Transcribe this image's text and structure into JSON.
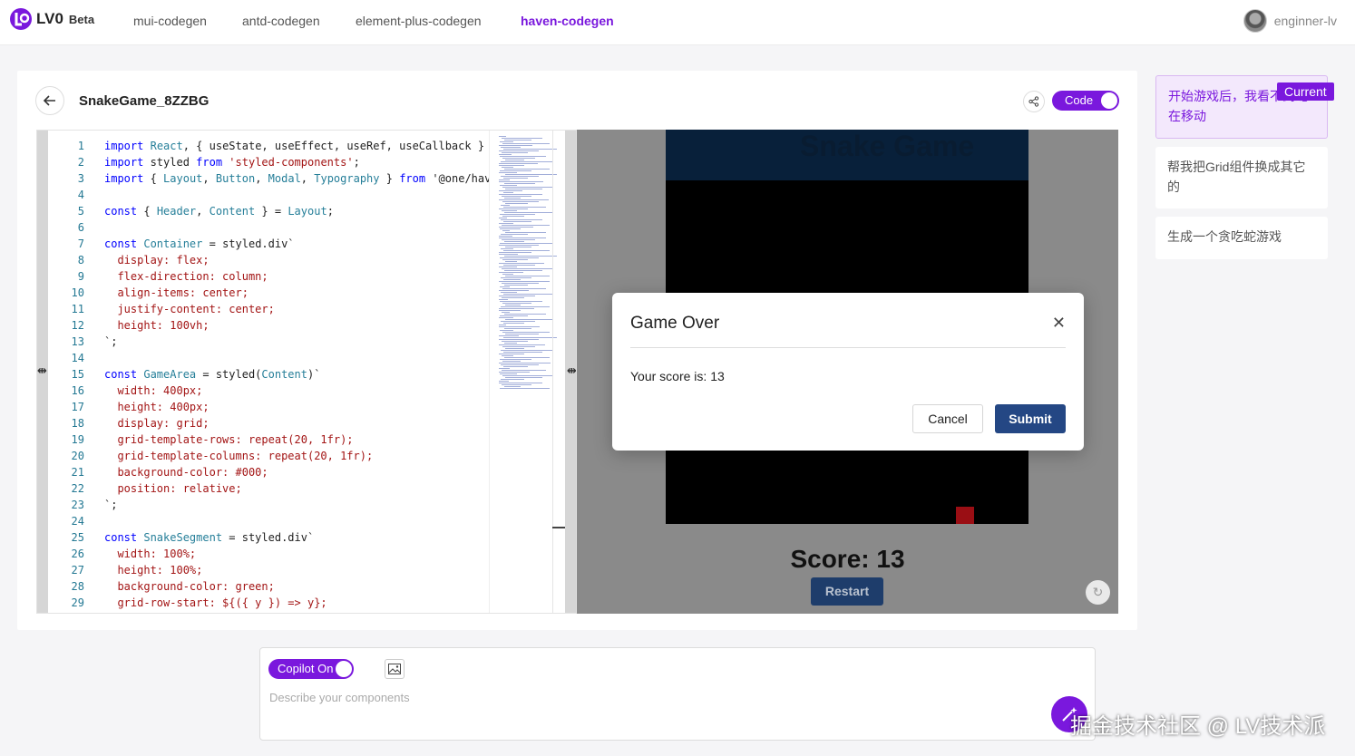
{
  "brand": {
    "name": "LV0",
    "badge": "Beta"
  },
  "nav": {
    "links": [
      "mui-codegen",
      "antd-codegen",
      "element-plus-codegen",
      "haven-codegen"
    ],
    "active": "haven-codegen"
  },
  "user": {
    "name": "enginner-lv"
  },
  "project": {
    "title": "SnakeGame_8ZZBG",
    "code_toggle": "Code"
  },
  "editor": {
    "line_numbers": [
      "1",
      "2",
      "3",
      "4",
      "5",
      "6",
      "7",
      "8",
      "9",
      "10",
      "11",
      "12",
      "13",
      "14",
      "15",
      "16",
      "17",
      "18",
      "19",
      "20",
      "21",
      "22",
      "23",
      "24",
      "25",
      "26",
      "27",
      "28",
      "29"
    ],
    "lines": [
      "import React, { useState, useEffect, useRef, useCallback }",
      "import styled from 'styled-components';",
      "import { Layout, Button, Modal, Typography } from '@one/hav",
      "",
      "const { Header, Content } = Layout;",
      "",
      "const Container = styled.div`",
      "  display: flex;",
      "  flex-direction: column;",
      "  align-items: center;",
      "  justify-content: center;",
      "  height: 100vh;",
      "`;",
      "",
      "const GameArea = styled(Content)`",
      "  width: 400px;",
      "  height: 400px;",
      "  display: grid;",
      "  grid-template-rows: repeat(20, 1fr);",
      "  grid-template-columns: repeat(20, 1fr);",
      "  background-color: #000;",
      "  position: relative;",
      "`;",
      "",
      "const SnakeSegment = styled.div`",
      "  width: 100%;",
      "  height: 100%;",
      "  background-color: green;",
      "  grid-row-start: ${({ y }) => y};"
    ]
  },
  "preview": {
    "game_title": "Snake Game",
    "score_text": "Score: 13",
    "restart_label": "Restart"
  },
  "modal": {
    "title": "Game Over",
    "body": "Your score is: 13",
    "cancel_label": "Cancel",
    "submit_label": "Submit"
  },
  "history": {
    "current_badge": "Current",
    "items": [
      "开始游戏后，我看不到蛇在移动",
      "帮我把Grid组件换成其它的",
      "生成一个贪吃蛇游戏"
    ]
  },
  "composer": {
    "copilot_label": "Copilot On",
    "placeholder": "Describe your components"
  },
  "watermark": "掘金技术社区 @ LV技术派",
  "colors": {
    "accent": "#7a18dd",
    "submit": "#244784",
    "restart": "#1e3d6b",
    "food": "#9a0e14"
  }
}
